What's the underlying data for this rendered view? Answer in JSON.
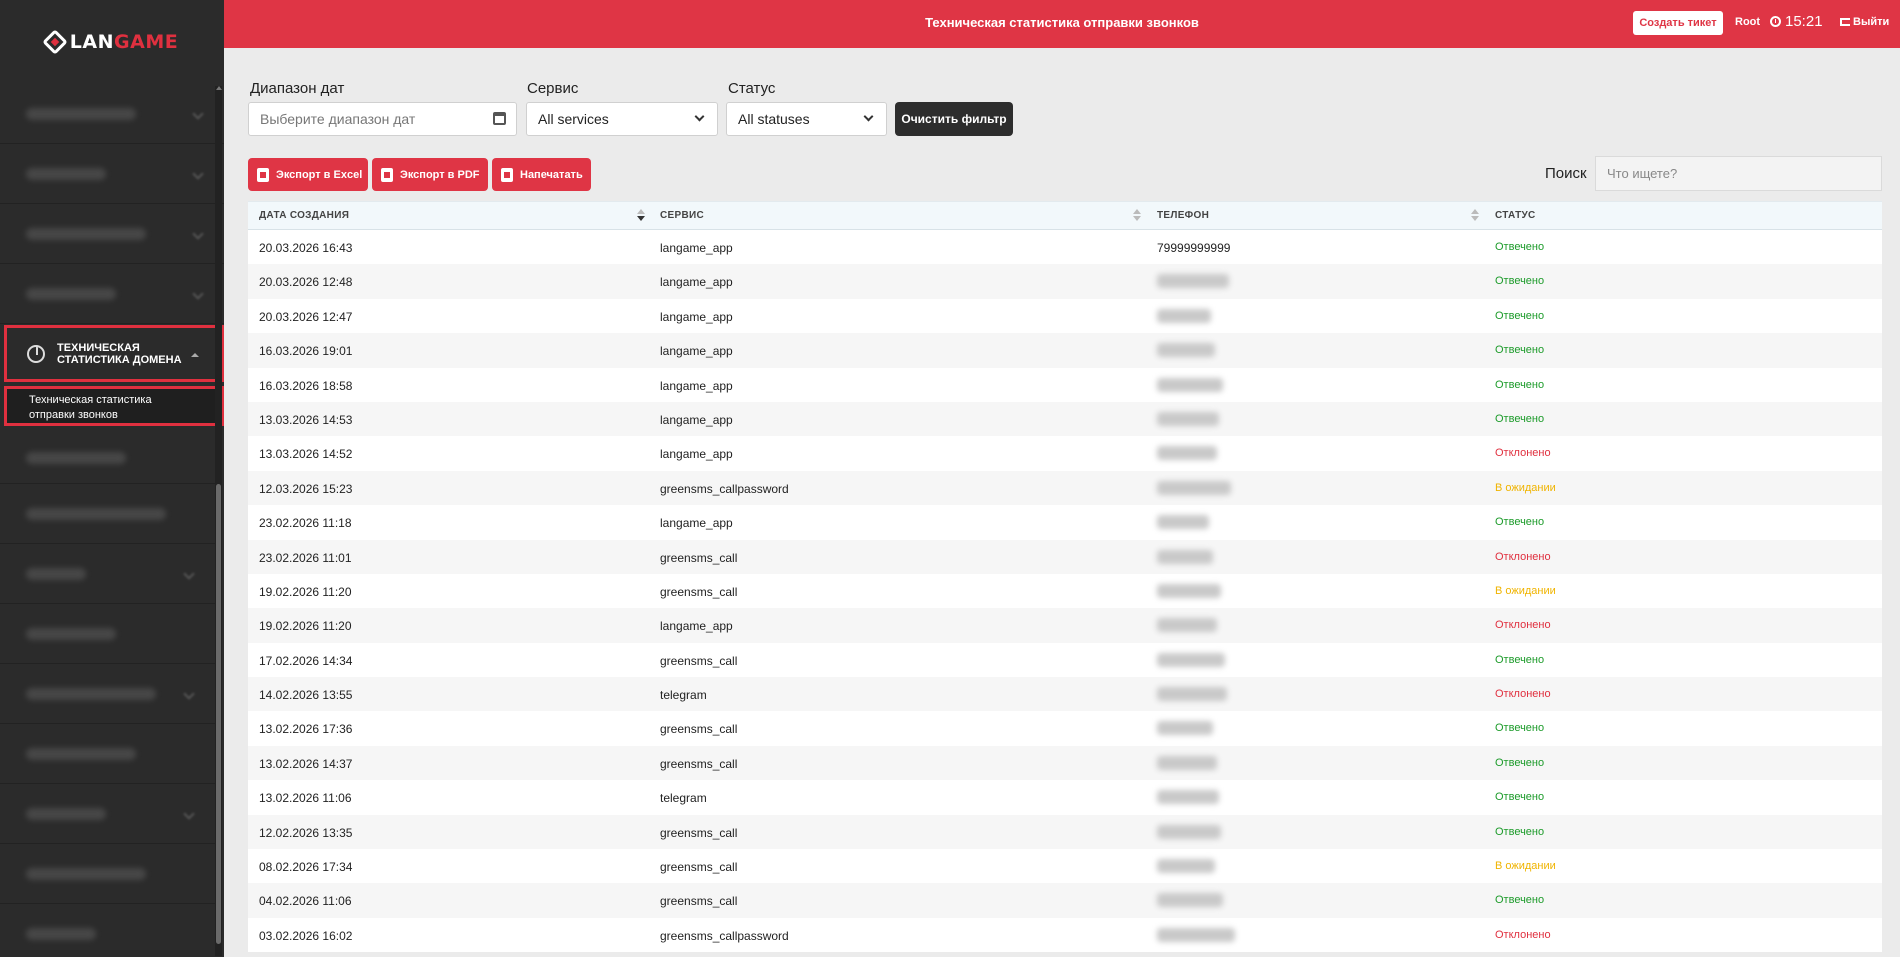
{
  "app": {
    "page_title": "Техническая статистика отправки звонков"
  },
  "header": {
    "create_ticket": "Создать тикет",
    "user": "Root",
    "time": "15:21",
    "logout": "Выйти"
  },
  "sidebar": {
    "active_section": "Техническая статистика домена",
    "active_item": "Техническая статистика отправки звонков"
  },
  "filters": {
    "date_label": "Диапазон дат",
    "date_placeholder": "Выберите диапазон дат",
    "service_label": "Сервис",
    "service_value": "All services",
    "status_label": "Статус",
    "status_value": "All statuses",
    "clear_button": "Очистить фильтр"
  },
  "toolbar": {
    "export_excel": "Экспорт в Excel",
    "export_pdf": "Экспорт в PDF",
    "print": "Напечатать",
    "search_label": "Поиск",
    "search_placeholder": "Что ищете?"
  },
  "table": {
    "columns": [
      "ДАТА СОЗДАНИЯ",
      "СЕРВИС",
      "ТЕЛЕФОН",
      "СТАТУС"
    ],
    "rows": [
      {
        "date": "20.03.2026 16:43",
        "service": "langame_app",
        "phone": "79999999999",
        "status": "Отвечено"
      },
      {
        "date": "20.03.2026 12:48",
        "service": "langame_app",
        "phone": "",
        "status": "Отвечено"
      },
      {
        "date": "20.03.2026 12:47",
        "service": "langame_app",
        "phone": "",
        "status": "Отвечено"
      },
      {
        "date": "16.03.2026 19:01",
        "service": "langame_app",
        "phone": "",
        "status": "Отвечено"
      },
      {
        "date": "16.03.2026 18:58",
        "service": "langame_app",
        "phone": "",
        "status": "Отвечено"
      },
      {
        "date": "13.03.2026 14:53",
        "service": "langame_app",
        "phone": "",
        "status": "Отвечено"
      },
      {
        "date": "13.03.2026 14:52",
        "service": "langame_app",
        "phone": "",
        "status": "Отклонено"
      },
      {
        "date": "12.03.2026 15:23",
        "service": "greensms_callpassword",
        "phone": "",
        "status": "В ожидании"
      },
      {
        "date": "23.02.2026 11:18",
        "service": "langame_app",
        "phone": "",
        "status": "Отвечено"
      },
      {
        "date": "23.02.2026 11:01",
        "service": "greensms_call",
        "phone": "",
        "status": "Отклонено"
      },
      {
        "date": "19.02.2026 11:20",
        "service": "greensms_call",
        "phone": "",
        "status": "В ожидании"
      },
      {
        "date": "19.02.2026 11:20",
        "service": "langame_app",
        "phone": "",
        "status": "Отклонено"
      },
      {
        "date": "17.02.2026 14:34",
        "service": "greensms_call",
        "phone": "",
        "status": "Отвечено"
      },
      {
        "date": "14.02.2026 13:55",
        "service": "telegram",
        "phone": "",
        "status": "Отклонено"
      },
      {
        "date": "13.02.2026 17:36",
        "service": "greensms_call",
        "phone": "",
        "status": "Отвечено"
      },
      {
        "date": "13.02.2026 14:37",
        "service": "greensms_call",
        "phone": "",
        "status": "Отвечено"
      },
      {
        "date": "13.02.2026 11:06",
        "service": "telegram",
        "phone": "",
        "status": "Отвечено"
      },
      {
        "date": "12.02.2026 13:35",
        "service": "greensms_call",
        "phone": "",
        "status": "Отвечено"
      },
      {
        "date": "08.02.2026 17:34",
        "service": "greensms_call",
        "phone": "",
        "status": "В ожидании"
      },
      {
        "date": "04.02.2026 11:06",
        "service": "greensms_call",
        "phone": "",
        "status": "Отвечено"
      },
      {
        "date": "03.02.2026 16:02",
        "service": "greensms_callpassword",
        "phone": "",
        "status": "Отклонено"
      }
    ]
  },
  "colors": {
    "accent": "#df3545",
    "sidebar": "#2b2b2b",
    "status_answered": "#1c9b2a",
    "status_rejected": "#e0303f",
    "status_pending": "#f0b400"
  }
}
